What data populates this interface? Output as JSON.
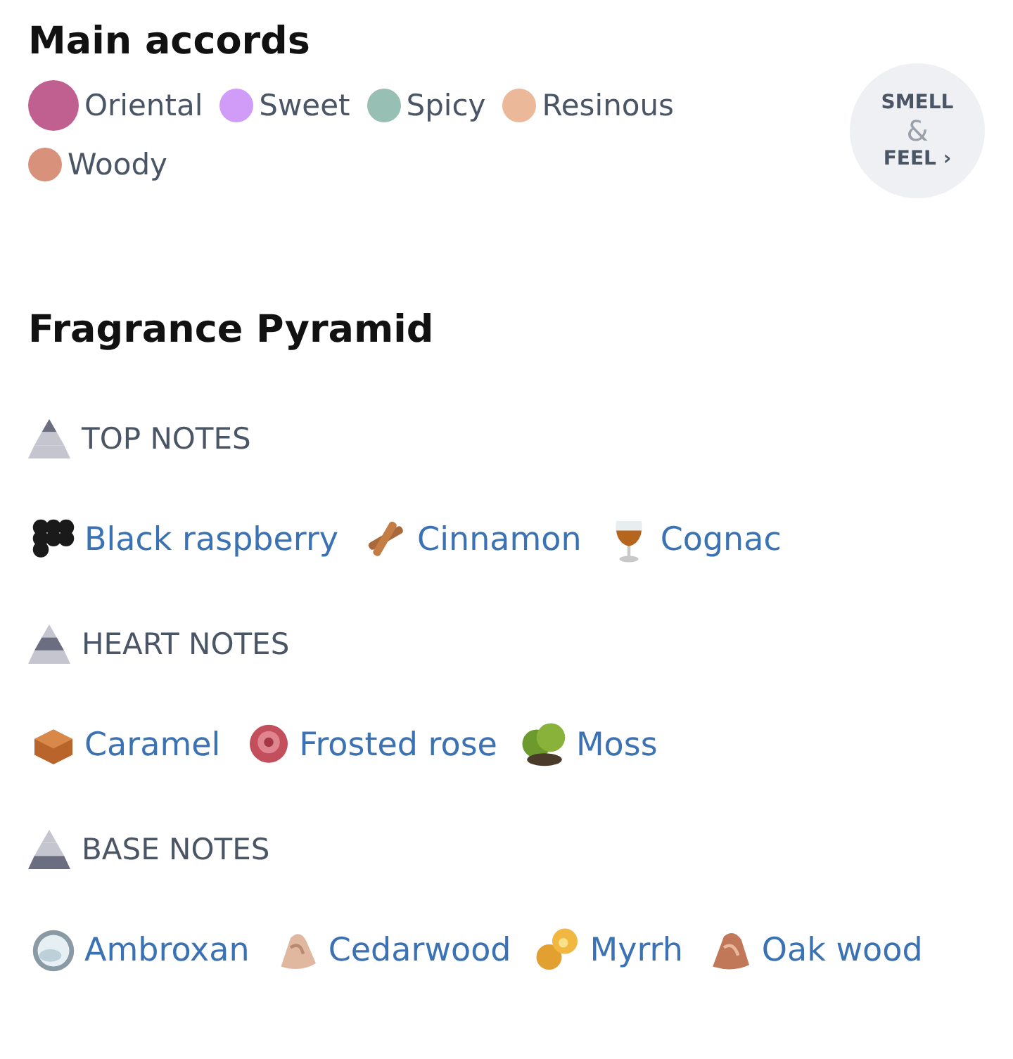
{
  "main_accords": {
    "title": "Main accords",
    "accords": [
      {
        "name": "Oriental",
        "color": "#c06090",
        "kind": "large"
      },
      {
        "name": "Sweet",
        "color": "#d09cf8",
        "kind": "small"
      },
      {
        "name": "Spicy",
        "color": "#98bfb4",
        "kind": "small"
      },
      {
        "name": "Resinous",
        "color": "#ebb89a",
        "kind": "small"
      },
      {
        "name": "Woody",
        "color": "#d8927c",
        "kind": "small"
      }
    ],
    "smell_feel_button": {
      "line_1": "SMELL",
      "ampersand": "&",
      "line_2": "FEEL",
      "chevron": "›"
    }
  },
  "pyramid": {
    "title": "Fragrance Pyramid",
    "sections": [
      {
        "kind": "top",
        "title": "TOP NOTES",
        "notes": [
          "Black raspberry",
          "Cinnamon",
          "Cognac"
        ]
      },
      {
        "kind": "heart",
        "title": "HEART NOTES",
        "notes": [
          "Caramel",
          "Frosted rose",
          "Moss"
        ]
      },
      {
        "kind": "base",
        "title": "BASE NOTES",
        "notes": [
          "Ambroxan",
          "Cedarwood",
          "Myrrh",
          "Oak wood"
        ]
      }
    ]
  }
}
